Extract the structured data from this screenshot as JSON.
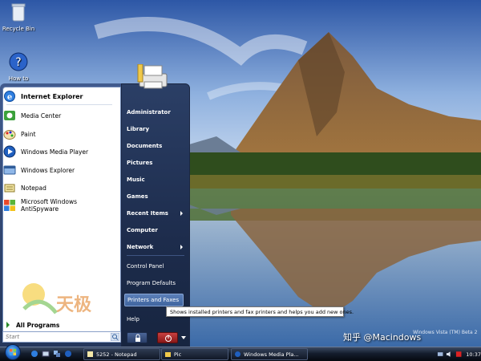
{
  "desktop": {
    "icons": [
      {
        "label": "Recycle Bin",
        "icon": "recycle-bin-icon"
      },
      {
        "label": "How to Report a Bug",
        "icon": "help-icon"
      }
    ],
    "wallpaper": "mountain-lake-reflection"
  },
  "start_menu": {
    "pinned": [
      {
        "label": "Internet Explorer",
        "icon": "internet-explorer-icon"
      }
    ],
    "recent_programs": [
      {
        "label": "Media Center",
        "icon": "media-center-icon"
      },
      {
        "label": "Paint",
        "icon": "paint-icon"
      },
      {
        "label": "Windows Media Player",
        "icon": "media-player-icon"
      },
      {
        "label": "Windows Explorer",
        "icon": "explorer-icon"
      },
      {
        "label": "Notepad",
        "icon": "notepad-icon"
      },
      {
        "label": "Microsoft Windows AntiSpyware",
        "icon": "antispyware-icon"
      }
    ],
    "all_programs_label": "All Programs",
    "search_placeholder": "Start",
    "right_items": [
      {
        "label": "Administrator"
      },
      {
        "label": "Library"
      },
      {
        "label": "Documents"
      },
      {
        "label": "Pictures"
      },
      {
        "label": "Music"
      },
      {
        "label": "Games"
      },
      {
        "label": "Recent Items"
      },
      {
        "label": "Computer"
      },
      {
        "label": "Network"
      },
      {
        "label": "Control Panel"
      },
      {
        "label": "Program Defaults"
      },
      {
        "label": "Printers and Faxes"
      },
      {
        "label": "Help"
      }
    ],
    "highlighted_item": "Printers and Faxes"
  },
  "tooltip": {
    "text": "Shows installed printers and fax printers and helps you add new ones."
  },
  "taskbar": {
    "buttons": [
      {
        "label": "5252 - Notepad",
        "icon": "notepad-icon"
      },
      {
        "label": "Pic",
        "icon": "folder-icon"
      },
      {
        "label": "Windows Media Pla...",
        "icon": "media-player-icon"
      }
    ],
    "clock": "10:37"
  },
  "overlay": {
    "watermark": "知乎 @Macindows",
    "build_text": "Windows Vista (TM) Beta 2",
    "site_logo_text": "天极"
  },
  "colors": {
    "start_menu_right_bg": "#1d2c4c",
    "taskbar_bg": "#141d2d",
    "highlight": "#5b7fb8"
  }
}
